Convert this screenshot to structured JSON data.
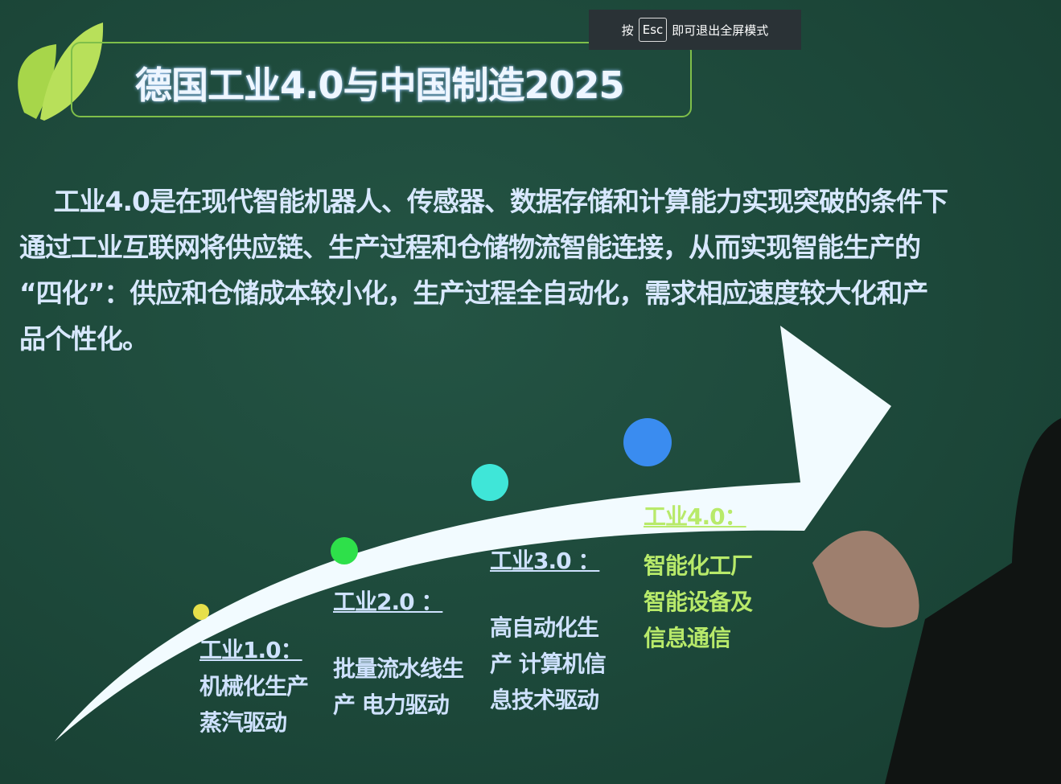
{
  "fullscreen_hint": {
    "prefix": "按",
    "key": "Esc",
    "suffix": "即可退出全屏模式"
  },
  "slide": {
    "title": "德国工业4.0与中国制造2025",
    "paragraph": [
      "　 工业4.0是在现代智能机器人、传感器、数据存储和计算能力实现突破的条件下",
      "通过工业互联网将供应链、生产过程和仓储物流智能连接，从而实现智能生产的",
      "“四化”：供应和仓储成本较小化，生产过程全自动化，需求相应速度较大化和产",
      "品个性化。"
    ],
    "stages": [
      {
        "heading": "工业1.0：",
        "lines": [
          "机械化生产",
          "蒸汽驱动"
        ],
        "dot_color": "#e6e04a"
      },
      {
        "heading": "工业2.0 ：",
        "lines": [
          "批量流水线生",
          "产 电力驱动"
        ],
        "dot_color": "#2ee04a"
      },
      {
        "heading": "工业3.0 ：",
        "lines": [
          "高自动化生",
          "产 计算机信",
          "息技术驱动"
        ],
        "dot_color": "#3fe6d8"
      },
      {
        "heading": "工业4.0：",
        "lines": [
          "智能化工厂",
          "智能设备及",
          "信息通信"
        ],
        "dot_color": "#3a8cf0"
      }
    ]
  }
}
